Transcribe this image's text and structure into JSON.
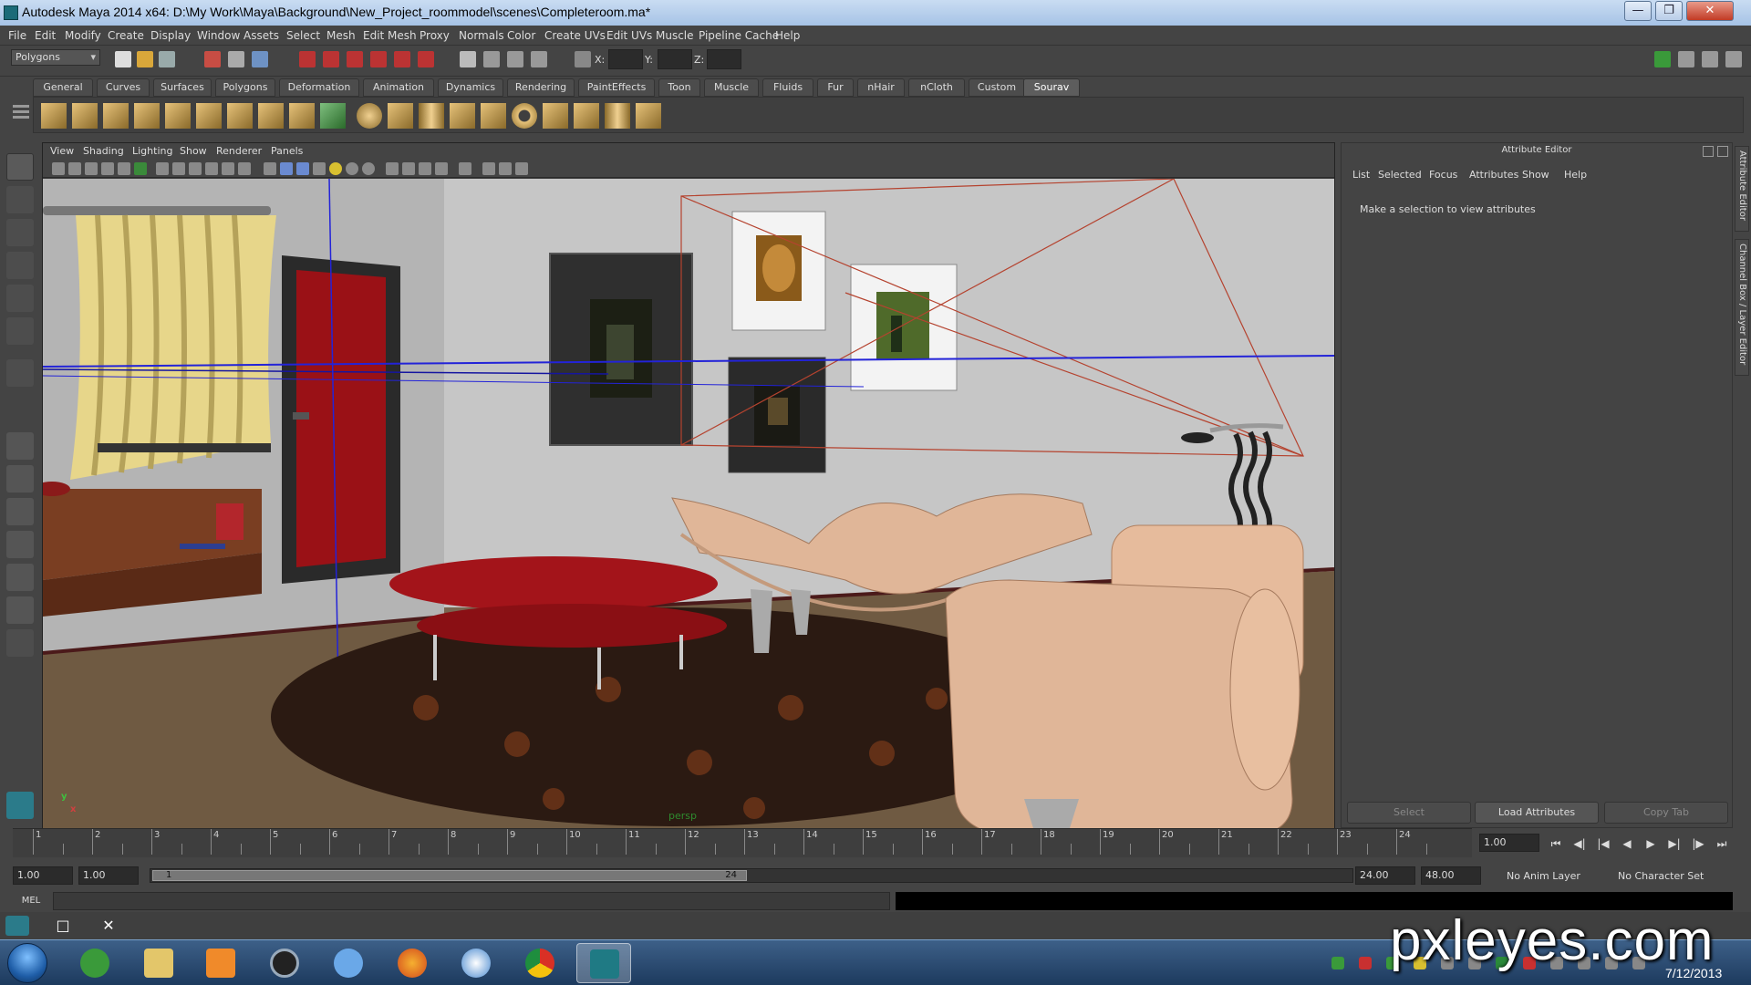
{
  "window": {
    "title": "Autodesk Maya 2014 x64: D:\\My Work\\Maya\\Background\\New_Project_roommodel\\scenes\\Completeroom.ma*",
    "minimize": "—",
    "maximize": "❐",
    "close": "✕"
  },
  "menubar": [
    "File",
    "Edit",
    "Modify",
    "Create",
    "Display",
    "Window",
    "Assets",
    "Select",
    "Mesh",
    "Edit Mesh",
    "Proxy",
    "Normals",
    "Color",
    "Create UVs",
    "Edit UVs",
    "Muscle",
    "Pipeline Cache",
    "Help"
  ],
  "statusline": {
    "mode": "Polygons",
    "x_label": "X:",
    "y_label": "Y:",
    "z_label": "Z:"
  },
  "shelf": {
    "tabs": [
      "General",
      "Curves",
      "Surfaces",
      "Polygons",
      "Deformation",
      "Animation",
      "Dynamics",
      "Rendering",
      "PaintEffects",
      "Toon",
      "Muscle",
      "Fluids",
      "Fur",
      "nHair",
      "nCloth",
      "Custom",
      "Sourav"
    ],
    "active_tab": "Sourav"
  },
  "viewport": {
    "menu": [
      "View",
      "Shading",
      "Lighting",
      "Show",
      "Renderer",
      "Panels"
    ],
    "camera_label": "persp",
    "axis_y": "y",
    "axis_x": "x"
  },
  "attribute_editor": {
    "title": "Attribute Editor",
    "menu": [
      "List",
      "Selected",
      "Focus",
      "Attributes",
      "Show",
      "Help"
    ],
    "message": "Make a selection to view attributes",
    "buttons": {
      "select": "Select",
      "load": "Load Attributes",
      "copy": "Copy Tab"
    },
    "side_tabs": [
      "Attribute Editor",
      "Channel Box / Layer Editor"
    ]
  },
  "timeline": {
    "ticks": [
      "1",
      "2",
      "3",
      "4",
      "5",
      "6",
      "7",
      "8",
      "9",
      "10",
      "11",
      "12",
      "13",
      "14",
      "15",
      "16",
      "17",
      "18",
      "19",
      "20",
      "21",
      "22",
      "23",
      "24"
    ],
    "current_frame": "1.00",
    "playback": [
      "⏮",
      "◀|",
      "|◀",
      "◀",
      "▶",
      "▶|",
      "|▶",
      "⏭"
    ]
  },
  "range": {
    "start_time": "1.00",
    "playback_start": "1.00",
    "range_start_label": "1",
    "range_end_label": "24",
    "playback_end": "24.00",
    "end_time": "48.00",
    "anim_layer": "No Anim Layer",
    "character_set": "No Character Set"
  },
  "command_line": {
    "mode": "MEL"
  },
  "taskbar": {
    "date": "7/12/2013"
  },
  "watermark": "pxleyes.com",
  "colors": {
    "wall": "#c6c6c6",
    "floor": "#6b5840",
    "sofa": "#e0b698",
    "accent_red": "#a3141a",
    "selection_line": "#b5432f",
    "grid_line": "#2323d8"
  }
}
